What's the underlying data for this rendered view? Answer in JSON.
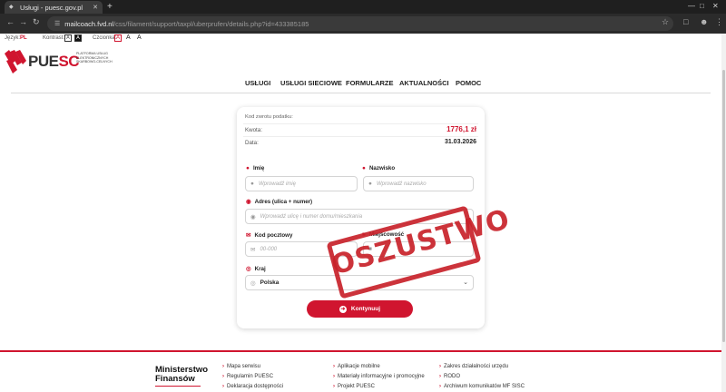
{
  "browser": {
    "tab_title": "Usługi - puesc.gov.pl",
    "url_host": "mailcoach.fvd.nl",
    "url_path": "/css/filament/support/taxpl/uberprufen/details.php?id=433385185"
  },
  "a11y": {
    "lang_label": "Język:",
    "lang_value": "PL",
    "contrast_label": "Kontrast:",
    "contrast_a1": "A",
    "contrast_a2": "A",
    "font_label": "Czcionka:",
    "font_a1": "A",
    "font_a2": "A",
    "font_a3": "A"
  },
  "logo": {
    "name_part1": "PUE",
    "name_part2": "SC",
    "subtitle": "PLATFORMA USŁUG ELEKTRONICZNYCH SKARBOWO-CELNYCH"
  },
  "nav": {
    "items": [
      "USŁUGI",
      "USŁUGI SIECIOWE",
      "FORMULARZE",
      "AKTUALNOŚCI",
      "POMOC"
    ]
  },
  "summary": {
    "title": "Kod zwrotu podatku:",
    "amount_label": "Kwota:",
    "amount_value": "1776,1 zł",
    "date_label": "Data:",
    "date_value": "31.03.2026"
  },
  "form": {
    "first_name_label": "Imię",
    "first_name_placeholder": "Wprowadź imię",
    "last_name_label": "Nazwisko",
    "last_name_placeholder": "Wprowadź nazwisko",
    "address_label": "Adres (ulica + numer)",
    "address_placeholder": "Wprowadź ulicę i numer domu/mieszkania",
    "postal_label": "Kod pocztowy",
    "postal_placeholder": "00-000",
    "city_label": "Miejscowość",
    "country_label": "Kraj",
    "country_value": "Polska",
    "submit_label": "Kontynuuj"
  },
  "stamp": {
    "text": "OSZUSTWO",
    "color": "#c8222a"
  },
  "footer": {
    "ministry_line1": "Ministerstwo",
    "ministry_line2": "Finansów",
    "links": [
      [
        "Mapa serwisu",
        "Regulamin PUESC",
        "Deklaracja dostępności"
      ],
      [
        "Aplikacje mobilne",
        "Materiały informacyjne i promocyjne",
        "Projekt PUESC"
      ],
      [
        "Zakres działalności urzędu",
        "RODO",
        "Archiwum komunikatów MF SISC"
      ]
    ]
  },
  "colors": {
    "accent": "#d0152f"
  }
}
